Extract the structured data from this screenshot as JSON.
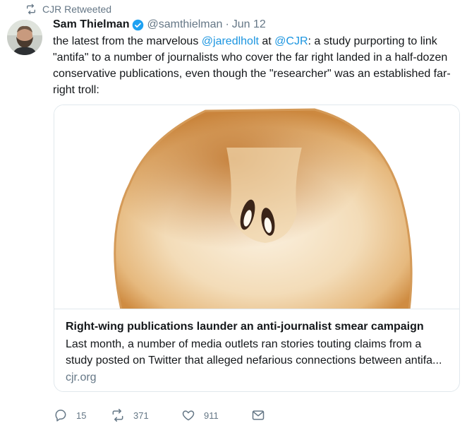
{
  "retweet_label": "CJR Retweeted",
  "author": {
    "name": "Sam Thielman",
    "handle": "@samthielman",
    "separator": "·",
    "date": "Jun 12"
  },
  "tweet": {
    "part1": "the latest from the marvelous ",
    "mention1": "@jaredlholt",
    "part2": " at ",
    "mention2": "@CJR",
    "part3": ": a study purporting to link \"antifa\" to a number of journalists who cover the far right landed in a half-dozen conservative publications, even though the \"researcher\" was an established far-right troll:"
  },
  "card": {
    "title": "Right-wing publications launder an anti-journalist smear campaign",
    "description": "Last month, a number of media outlets ran stories touting claims from a study posted on Twitter that alleged nefarious connections between antifa...",
    "domain": "cjr.org"
  },
  "actions": {
    "replies": "15",
    "retweets": "371",
    "likes": "911"
  },
  "colors": {
    "link": "#1b95e0",
    "muted": "#657786",
    "border": "#e1e8ed"
  },
  "icons": [
    "retweet-icon",
    "verified-badge-icon",
    "reply-icon",
    "like-icon",
    "direct-message-icon"
  ]
}
